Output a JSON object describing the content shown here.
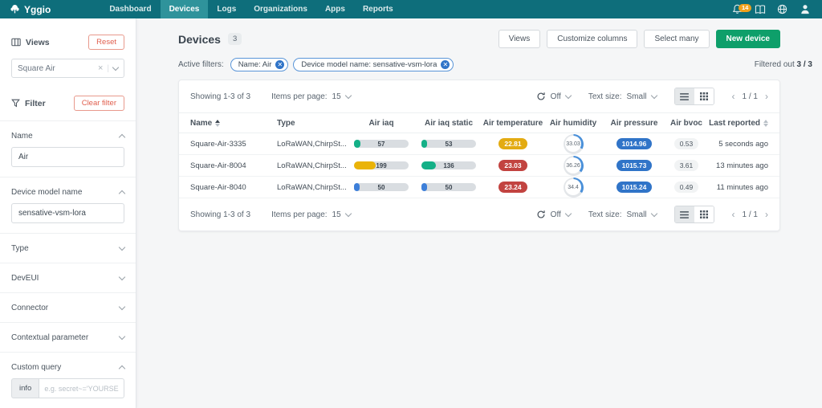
{
  "navbar": {
    "brand": "Yggio",
    "items": [
      {
        "label": "Dashboard"
      },
      {
        "label": "Devices"
      },
      {
        "label": "Logs"
      },
      {
        "label": "Organizations"
      },
      {
        "label": "Apps"
      },
      {
        "label": "Reports"
      }
    ],
    "notification_count": "14"
  },
  "sidebar": {
    "views_title": "Views",
    "reset_button": "Reset",
    "views_select_value": "Square Air",
    "filter_title": "Filter",
    "clear_filter_button": "Clear filter",
    "name_section": {
      "label": "Name",
      "value": "Air"
    },
    "model_section": {
      "label": "Device model name",
      "value": "sensative-vsm-lora"
    },
    "collapsed_sections": [
      {
        "label": "Type"
      },
      {
        "label": "DevEUI"
      },
      {
        "label": "Connector"
      },
      {
        "label": "Contextual parameter"
      }
    ],
    "custom_query": {
      "label": "Custom query",
      "info_button": "info",
      "placeholder": "e.g. secret~='YOURSECRET'"
    }
  },
  "header": {
    "title": "Devices",
    "count": "3",
    "views_button": "Views",
    "customize_button": "Customize columns",
    "select_many_button": "Select many",
    "new_device_button": "New device",
    "active_filters_label": "Active filters:",
    "filter_chips": [
      {
        "label": "Name: Air"
      },
      {
        "label": "Device model name: sensative-vsm-lora"
      }
    ],
    "filtered_out_label": "Filtered out",
    "filtered_out_value": "3 / 3"
  },
  "table": {
    "showing": "Showing 1-3 of 3",
    "items_per_page_label": "Items per page:",
    "items_per_page": "15",
    "refresh_state": "Off",
    "text_size_label": "Text size:",
    "text_size": "Small",
    "page_indicator": "1 / 1",
    "columns": [
      "Name",
      "Type",
      "Air iaq",
      "Air iaq static",
      "Air temperature",
      "Air humidity",
      "Air pressure",
      "Air bvoc",
      "Last reported"
    ],
    "rows": [
      {
        "name": "Square-Air-3335",
        "type": "LoRaWAN,ChirpSt...",
        "iaq": {
          "value": "57",
          "pct": 12,
          "color": "#14b087"
        },
        "iaq_static": {
          "value": "53",
          "pct": 11,
          "color": "#14b087"
        },
        "temperature": {
          "value": "22.81",
          "color": "#e3ab12"
        },
        "humidity": {
          "value": "33.03",
          "pct": 33
        },
        "pressure": "1014.96",
        "bvoc": "0.53",
        "last_reported": "5 seconds ago"
      },
      {
        "name": "Square-Air-8004",
        "type": "LoRaWAN,ChirpSt...",
        "iaq": {
          "value": "199",
          "pct": 40,
          "color": "#eab308"
        },
        "iaq_static": {
          "value": "136",
          "pct": 27,
          "color": "#14b087"
        },
        "temperature": {
          "value": "23.03",
          "color": "#c24340"
        },
        "humidity": {
          "value": "36.26",
          "pct": 36
        },
        "pressure": "1015.73",
        "bvoc": "3.61",
        "last_reported": "13 minutes ago"
      },
      {
        "name": "Square-Air-8040",
        "type": "LoRaWAN,ChirpSt...",
        "iaq": {
          "value": "50",
          "pct": 10,
          "color": "#3d7fd9"
        },
        "iaq_static": {
          "value": "50",
          "pct": 10,
          "color": "#3d7fd9"
        },
        "temperature": {
          "value": "23.24",
          "color": "#c24340"
        },
        "humidity": {
          "value": "34.4",
          "pct": 34
        },
        "pressure": "1015.24",
        "bvoc": "0.49",
        "last_reported": "11 minutes ago"
      }
    ]
  },
  "colors": {
    "navbar": "#0e6e7b",
    "navbar_active": "#2f939b",
    "primary_button": "#0e9f6a",
    "danger_accent": "#e05e4d",
    "chip_blue": "#3074c8",
    "pressure_badge": "#3074c8",
    "humidity_arc": "#4a90d9",
    "notification_badge": "#f0a11c"
  }
}
